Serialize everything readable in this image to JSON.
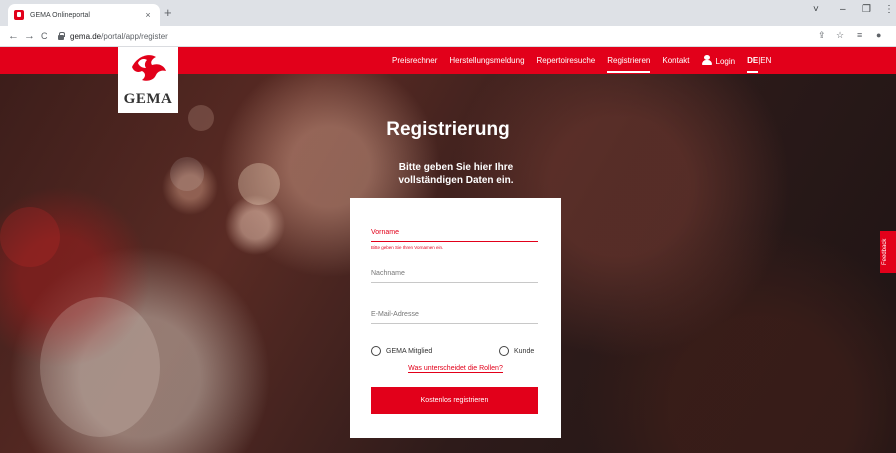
{
  "browser": {
    "tab_title": "GEMA Onlineportal",
    "tab_close": "×",
    "new_tab": "+",
    "url_host": "gema.de",
    "url_path": "/portal/app/register",
    "back": "←",
    "forward": "→",
    "reload": "C",
    "window_controls": [
      "˅",
      "–",
      "❐",
      "⋮"
    ]
  },
  "site": {
    "logo_text": "GEMA",
    "nav": [
      {
        "label": "Preisrechner"
      },
      {
        "label": "Herstellungsmeldung"
      },
      {
        "label": "Repertoiresuche"
      },
      {
        "label": "Registrieren",
        "active": true
      },
      {
        "label": "Kontakt"
      }
    ],
    "login": "Login",
    "lang_active": "DE",
    "lang_sep": "|",
    "lang_other": "EN"
  },
  "register": {
    "title": "Registrierung",
    "subtitle": "Bitte geben Sie hier Ihre vollständigen Daten ein.",
    "fields": {
      "firstname": {
        "label": "Vorname",
        "error": "Bitte geben Sie Ihren Vornamen ein."
      },
      "lastname": {
        "label": "Nachname"
      },
      "email": {
        "label": "E-Mail-Adresse"
      }
    },
    "roles": [
      {
        "label": "GEMA Mitglied"
      },
      {
        "label": "Kunde"
      }
    ],
    "roles_link": "Was unterscheidet die Rollen?",
    "submit": "Kostenlos registrieren"
  },
  "feedback": "Feedback",
  "colors": {
    "brand_red": "#e2001a"
  }
}
